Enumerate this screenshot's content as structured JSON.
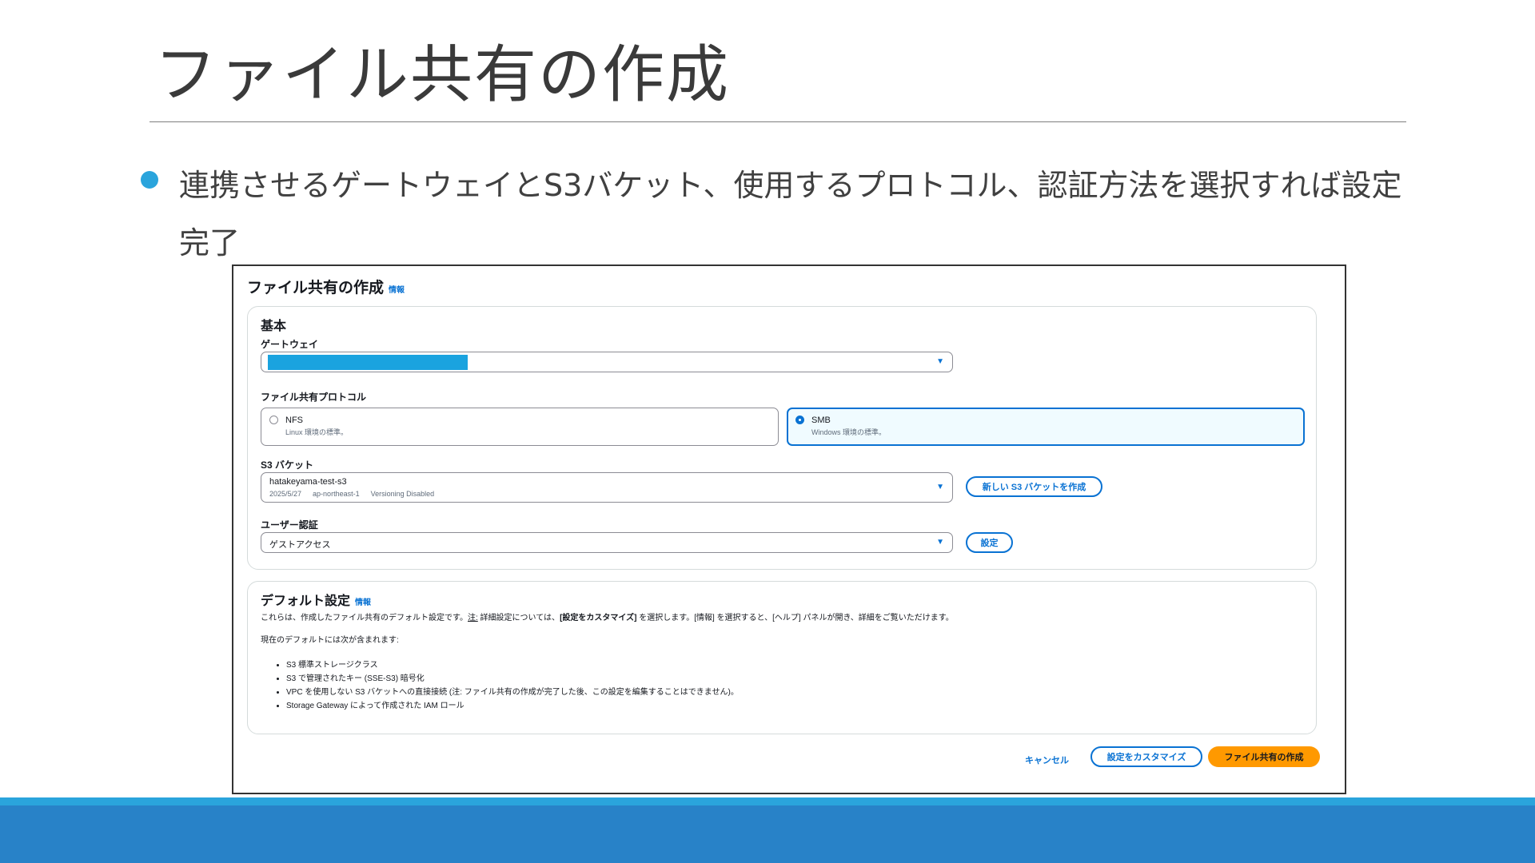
{
  "slide": {
    "title": "ファイル共有の作成",
    "bullet": "連携させるゲートウェイとS3バケット、使用するプロトコル、認証方法を選択すれば設定完了"
  },
  "form": {
    "title": "ファイル共有の作成",
    "info": "情報",
    "basic": {
      "heading": "基本",
      "gateway_label": "ゲートウェイ",
      "protocol_label": "ファイル共有プロトコル",
      "protocols": [
        {
          "name": "NFS",
          "desc": "Linux 環境の標準。",
          "selected": false
        },
        {
          "name": "SMB",
          "desc": "Windows 環境の標準。",
          "selected": true
        }
      ],
      "bucket_label": "S3 バケット",
      "bucket": {
        "name": "hatakeyama-test-s3",
        "date": "2025/5/27",
        "region": "ap-northeast-1",
        "versioning": "Versioning Disabled"
      },
      "new_bucket_button": "新しい S3 バケットを作成",
      "auth_label": "ユーザー認証",
      "auth_value": "ゲストアクセス",
      "settings_button": "設定"
    },
    "defaults": {
      "heading": "デフォルト設定",
      "info": "情報",
      "desc_a": "これらは、作成したファイル共有のデフォルト設定です。",
      "desc_note": "注:",
      "desc_b": " 詳細設定については、",
      "desc_bold": "[設定をカスタマイズ]",
      "desc_c": " を選択します。[情報] を選択すると、[ヘルプ] パネルが開き、詳細をご覧いただけます。",
      "includes": "現在のデフォルトには次が含まれます:",
      "items": [
        "S3 標準ストレージクラス",
        "S3 で管理されたキー (SSE-S3) 暗号化",
        "VPC を使用しない S3 バケットへの直接接続 (注: ファイル共有の作成が完了した後、この設定を編集することはできません)。",
        "Storage Gateway によって作成された IAM ロール"
      ]
    },
    "actions": {
      "cancel": "キャンセル",
      "customize": "設定をカスタマイズ",
      "create": "ファイル共有の作成"
    }
  },
  "colors": {
    "accent": "#2aa4dc",
    "footer": "#2882c8",
    "link": "#0972d3",
    "primary": "#ff9900"
  }
}
